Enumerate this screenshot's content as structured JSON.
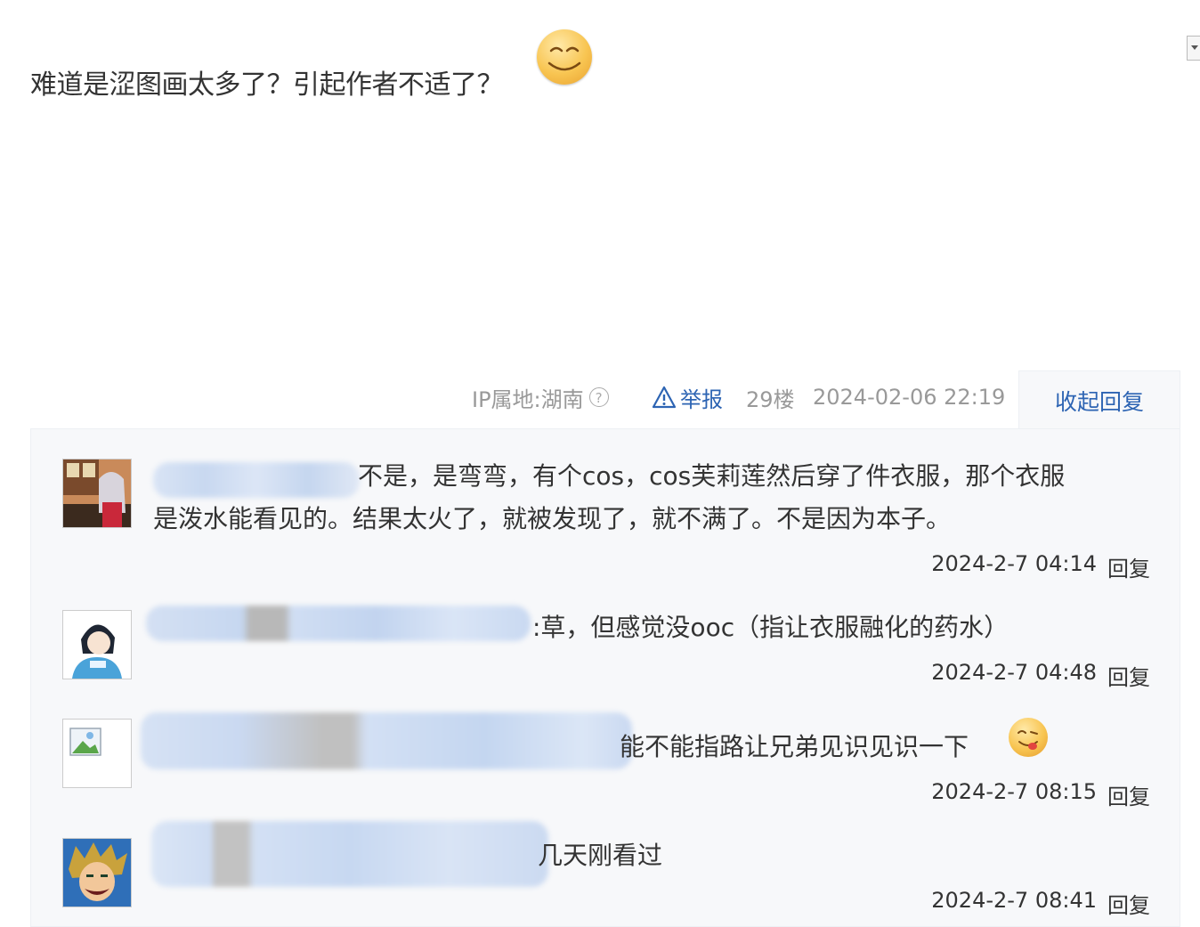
{
  "post": {
    "text": "难道是涩图画太多了？引起作者不适了？",
    "emoji_icon": "smile-emoji-icon"
  },
  "meta": {
    "ip_location": "IP属地:湖南",
    "help_glyph": "?",
    "report_label": "举报",
    "floor": "29楼",
    "time": "2024-02-06 22:19",
    "collapse_label": "收起回复"
  },
  "replies": [
    {
      "text_line1": "不是，是弯弯，有个cos，cos芙莉莲然后穿了件衣服，那个衣服",
      "text_line2": "是泼水能看见的。结果太火了，就被发现了，就不满了。不是因为本子。",
      "time": "2024-2-7 04:14",
      "reply_label": "回复"
    },
    {
      "text": ":草，但感觉没ooc（指让衣服融化的药水）",
      "time": "2024-2-7 04:48",
      "reply_label": "回复"
    },
    {
      "text": "能不能指路让兄弟见识见识一下",
      "emoji_icon": "tongue-emoji-icon",
      "time": "2024-2-7 08:15",
      "reply_label": "回复"
    },
    {
      "text": "几天刚看过",
      "time": "2024-2-7 08:41",
      "reply_label": "回复"
    }
  ],
  "colors": {
    "link_blue": "#2d64b3",
    "meta_gray": "#999999",
    "reply_bg": "#f7f8fa"
  }
}
